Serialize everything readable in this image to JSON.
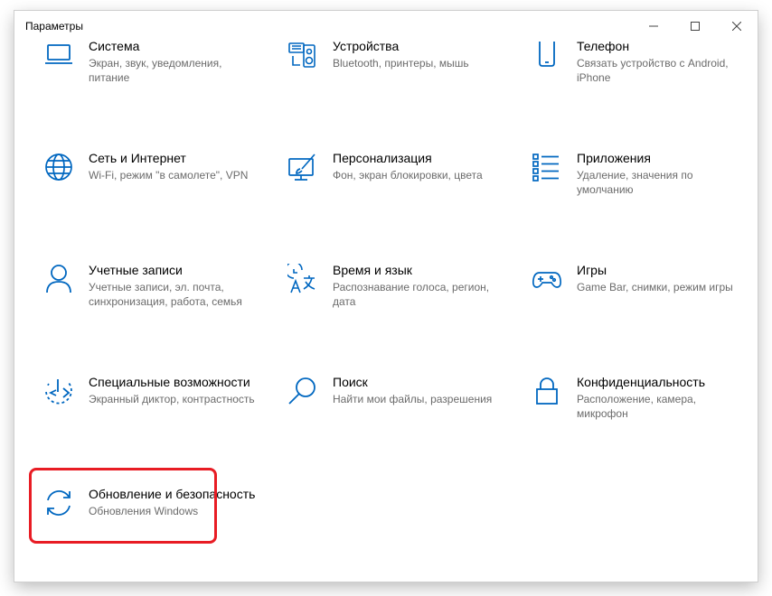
{
  "window": {
    "title": "Параметры",
    "controls": [
      "minimize",
      "maximize",
      "close"
    ]
  },
  "accent_color": "#0067c0",
  "highlight_color": "#e81c24",
  "tiles": [
    {
      "icon": "laptop-icon",
      "name": "Система",
      "desc": "Экран, звук, уведомления, питание"
    },
    {
      "icon": "devices-icon",
      "name": "Устройства",
      "desc": "Bluetooth, принтеры, мышь"
    },
    {
      "icon": "phone-icon",
      "name": "Телефон",
      "desc": "Связать устройство с Android, iPhone"
    },
    {
      "icon": "globe-icon",
      "name": "Сеть и Интернет",
      "desc": "Wi-Fi, режим \"в самолете\", VPN"
    },
    {
      "icon": "personalization-icon",
      "name": "Персонализация",
      "desc": "Фон, экран блокировки, цвета"
    },
    {
      "icon": "apps-icon",
      "name": "Приложения",
      "desc": "Удаление, значения по умолчанию"
    },
    {
      "icon": "person-icon",
      "name": "Учетные записи",
      "desc": "Учетные записи, эл. почта, синхронизация, работа, семья"
    },
    {
      "icon": "time-language-icon",
      "name": "Время и язык",
      "desc": "Распознавание голоса, регион, дата"
    },
    {
      "icon": "gamepad-icon",
      "name": "Игры",
      "desc": "Game Bar, снимки, режим игры"
    },
    {
      "icon": "accessibility-icon",
      "name": "Специальные возможности",
      "desc": "Экранный диктор, контрастность"
    },
    {
      "icon": "search-icon",
      "name": "Поиск",
      "desc": "Найти мои файлы, разрешения"
    },
    {
      "icon": "lock-icon",
      "name": "Конфиденциальность",
      "desc": "Расположение, камера, микрофон"
    },
    {
      "icon": "update-icon",
      "name": "Обновление и безопасность",
      "desc": "Обновления Windows",
      "highlighted": true
    }
  ]
}
